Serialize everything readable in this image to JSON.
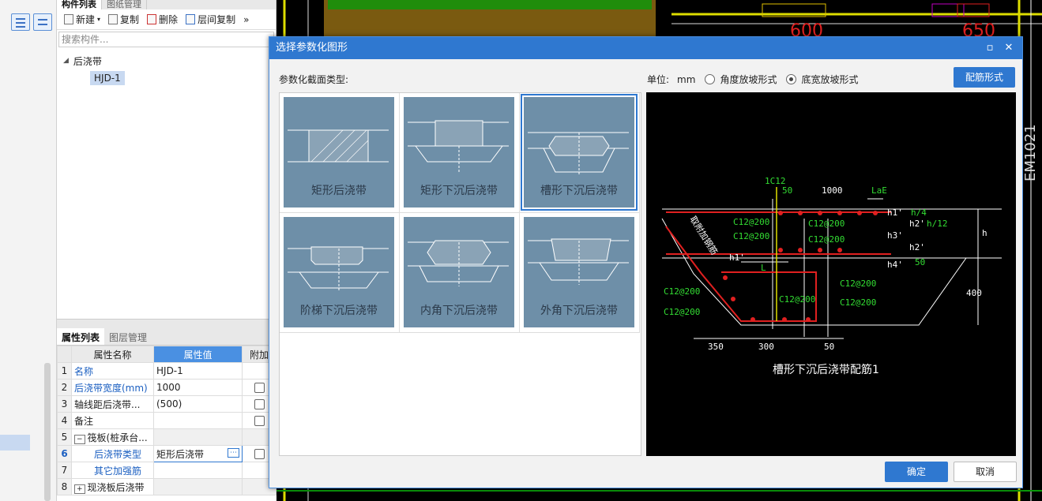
{
  "component_panel": {
    "tabs": [
      "构件列表",
      "图纸管理"
    ],
    "toolbar": {
      "new": "新建",
      "copy": "复制",
      "delete": "删除",
      "layer_copy": "层间复制",
      "more": "»"
    },
    "search_placeholder": "搜索构件...",
    "tree": {
      "root": "后浇带",
      "child": "HJD-1"
    }
  },
  "property_panel": {
    "tabs": [
      "属性列表",
      "图层管理"
    ],
    "headers": {
      "name": "属性名称",
      "value": "属性值",
      "extra": "附加"
    },
    "rows": [
      {
        "num": "1",
        "name": "名称",
        "value": "HJD-1"
      },
      {
        "num": "2",
        "name": "后浇带宽度(mm)",
        "value": "1000"
      },
      {
        "num": "3",
        "name": "轴线距后浇带...",
        "value": "(500)"
      },
      {
        "num": "4",
        "name": "备注",
        "value": ""
      },
      {
        "num": "5",
        "name": "筏板(桩承台...",
        "value": ""
      },
      {
        "num": "6",
        "name": "后浇带类型",
        "value": "矩形后浇带"
      },
      {
        "num": "7",
        "name": "其它加强筋",
        "value": ""
      },
      {
        "num": "8",
        "name": "现浇板后浇带",
        "value": ""
      }
    ]
  },
  "cad": {
    "labels": [
      "600",
      "650",
      "EM1021"
    ]
  },
  "dialog": {
    "title": "选择参数化图形",
    "section_label": "参数化截面类型:",
    "unit_label": "单位:",
    "unit_value": "mm",
    "radio_angle": "角度放坡形式",
    "radio_width": "底宽放坡形式",
    "rebar_button": "配筋形式",
    "shapes": [
      "矩形后浇带",
      "矩形下沉后浇带",
      "槽形下沉后浇带",
      "阶梯下沉后浇带",
      "内角下沉后浇带",
      "外角下沉后浇带"
    ],
    "selected_index": 2,
    "preview": {
      "caption": "槽形下沉后浇带配筋1",
      "labels": [
        "1C12",
        "50",
        "1000",
        "LaE",
        "h1'",
        "h/4",
        "h2'",
        "h/12",
        "h",
        "h3'",
        "h2'",
        "h4'",
        "50",
        "h1'",
        "L",
        "C12@200",
        "C12@200",
        "C12@200",
        "C12@200",
        "C12@200",
        "C12@200",
        "C12@200",
        "C12@200",
        "C12@200",
        "400",
        "350",
        "300",
        "50",
        "取附加钢筋"
      ]
    },
    "ok": "确定",
    "cancel": "取消"
  }
}
